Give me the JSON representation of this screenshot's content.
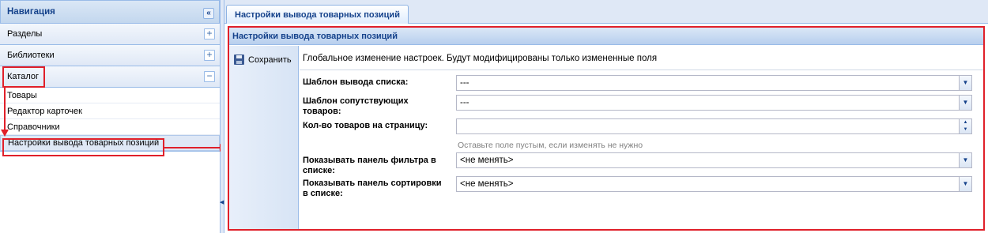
{
  "navigation": {
    "title": "Навигация",
    "collapse_icon": "double-chevron-left-icon",
    "sections": [
      {
        "label": "Разделы",
        "toggle": "+"
      },
      {
        "label": "Библиотеки",
        "toggle": "+"
      },
      {
        "label": "Каталог",
        "toggle": "−"
      }
    ],
    "catalog_items": [
      {
        "label": "Товары"
      },
      {
        "label": "Редактор карточек"
      },
      {
        "label": "Справочники"
      },
      {
        "label": "Настройки вывода товарных позиций"
      }
    ]
  },
  "tabs": [
    {
      "label": "Настройки вывода товарных позиций"
    }
  ],
  "panel": {
    "title": "Настройки вывода товарных позиций",
    "save_label": "Сохранить",
    "save_icon": "floppy-disk-icon",
    "note": "Глобальное изменение настроек. Будут модифицированы только измененные поля",
    "fields": [
      {
        "label": "Шаблон вывода списка:",
        "value": "---",
        "control": "dropdown"
      },
      {
        "label": "Шаблон сопутствующих товаров:",
        "value": "---",
        "control": "dropdown"
      },
      {
        "label": "Кол-во товаров на страницу:",
        "value": "",
        "control": "spinner"
      },
      {
        "label": "Показывать панель фильтра в списке:",
        "value": "<не менять>",
        "control": "dropdown"
      },
      {
        "label": "Показывать панель сортировки в списке:",
        "value": "<не менять>",
        "control": "dropdown"
      }
    ],
    "hint": "Оставьте поле пустым, если изменять не нужно"
  },
  "colors": {
    "accent": "#15428b",
    "annotation": "#e0202a",
    "panel_border": "#99bbe8"
  }
}
